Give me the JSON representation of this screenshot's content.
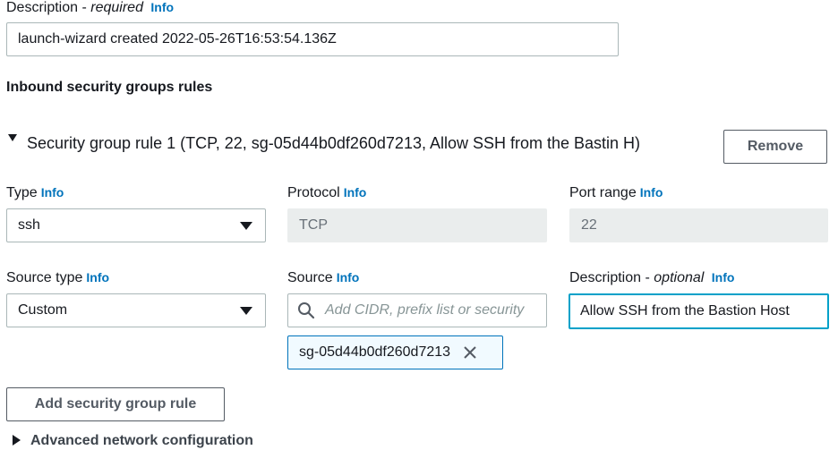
{
  "description": {
    "label": "Description",
    "qualifier": "required",
    "info": "Info",
    "value": "launch-wizard created 2022-05-26T16:53:54.136Z"
  },
  "inbound": {
    "heading": "Inbound security groups rules",
    "rule": {
      "title": "Security group rule 1 (TCP, 22, sg-05d44b0df260d7213, Allow SSH from the Bastin H)",
      "remove_label": "Remove",
      "type": {
        "label": "Type",
        "info": "Info",
        "value": "ssh"
      },
      "protocol": {
        "label": "Protocol",
        "info": "Info",
        "value": "TCP"
      },
      "port_range": {
        "label": "Port range",
        "info": "Info",
        "value": "22"
      },
      "source_type": {
        "label": "Source type",
        "info": "Info",
        "value": "Custom"
      },
      "source": {
        "label": "Source",
        "info": "Info",
        "placeholder": "Add CIDR, prefix list or security",
        "token": "sg-05d44b0df260d7213"
      },
      "rule_description": {
        "label": "Description",
        "qualifier": "optional",
        "info": "Info",
        "value": "Allow SSH from the Bastion Host"
      }
    },
    "add_rule_label": "Add security group rule"
  },
  "advanced": {
    "label": "Advanced network configuration"
  },
  "icons": {
    "search": "search-icon",
    "close": "close-icon",
    "caret_down": "caret-down-icon",
    "expand": "expand-triangle-icon"
  },
  "colors": {
    "accent": "#0073bb",
    "focus": "#00a1c9"
  }
}
